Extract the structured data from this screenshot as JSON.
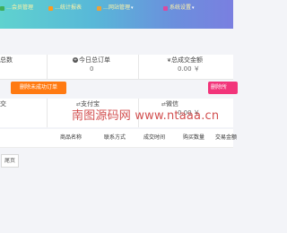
{
  "topnav": {
    "items": [
      {
        "label": "…会员管理",
        "icon": "users-icon",
        "icon_color": "#3fae5a"
      },
      {
        "label": "…统计报表",
        "icon": "chart-icon",
        "icon_color": "#ff9a1e"
      },
      {
        "label": "…网站管理",
        "icon": "globe-icon",
        "icon_color": "#e9a23b"
      },
      {
        "label": "系统设置",
        "icon": "gear-icon",
        "icon_color": "#d94aa0"
      }
    ]
  },
  "stats": {
    "first_label": "总数",
    "today_label": "今日总订单",
    "today_value": "0",
    "total_label": "总成交金额",
    "total_value": "0.00 ￥"
  },
  "actions": {
    "delete_unfinished": "删除未成功订单",
    "delete_right": "删除所"
  },
  "payments": {
    "first_label": "交",
    "alipay_label": "支付宝",
    "wechat_label": "微信",
    "wechat_value": "0.00 ￥"
  },
  "table": {
    "headers": [
      "商品名称",
      "联系方式",
      "成交时间",
      "购买数量",
      "交易金额"
    ]
  },
  "pagination": {
    "last_label": "尾页"
  },
  "watermark": {
    "text": "南图源码网 www.ntaaa.cn"
  },
  "colors": {
    "orange_button": "#ff7a12",
    "pink_button": "#f2347a",
    "nav_text": "#fff4a8"
  }
}
